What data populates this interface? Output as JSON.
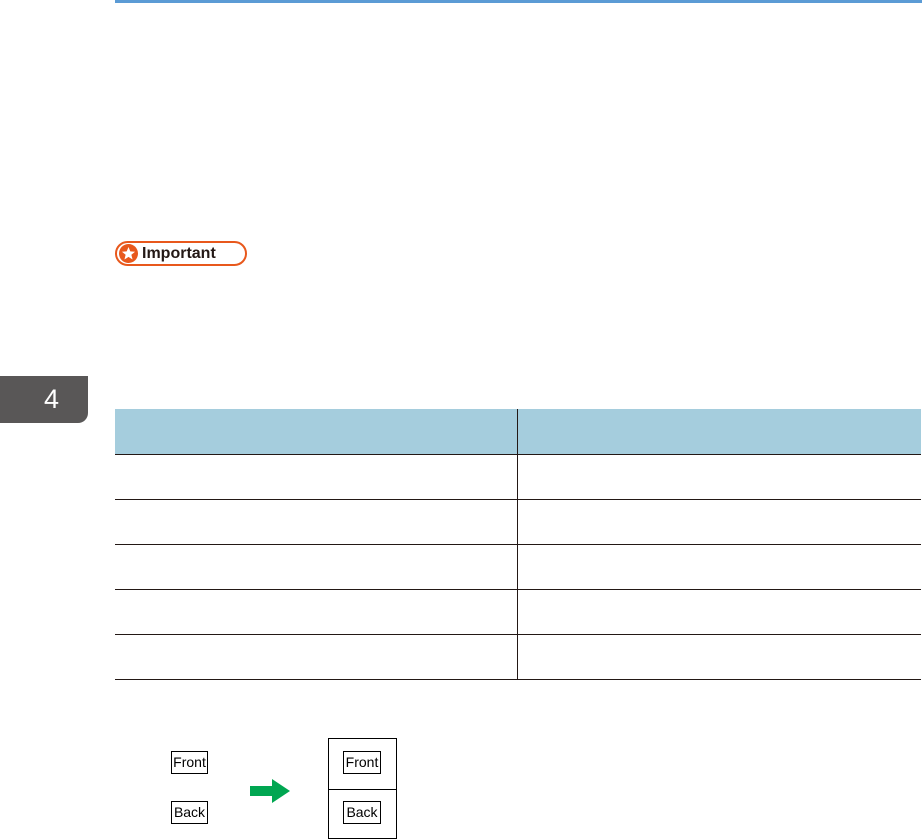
{
  "page": {
    "chapter_number": "4",
    "important_label": "Important"
  },
  "table": {
    "headers": [
      "",
      ""
    ],
    "rows": [
      [
        "",
        ""
      ],
      [
        "",
        ""
      ],
      [
        "",
        ""
      ],
      [
        "",
        ""
      ],
      [
        "",
        ""
      ]
    ]
  },
  "illustration": {
    "original": {
      "front_label": "Front",
      "back_label": "Back"
    },
    "arrow_icon": "green-right-arrow-icon",
    "result": {
      "front_label": "Front",
      "back_label": "Back"
    }
  },
  "colors": {
    "top_rule": "#5b9bd5",
    "chapter_tab": "#595757",
    "important_accent": "#e8581c",
    "table_header": "#a5cddd",
    "arrow": "#00a651"
  }
}
